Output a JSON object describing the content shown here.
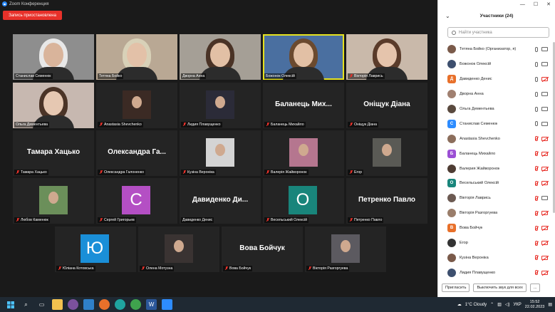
{
  "window": {
    "title": "Zoom Конференция",
    "record_button": "Запись приостановлена"
  },
  "gallery": [
    {
      "name": "Станислав Семенюк",
      "kind": "video",
      "muted": false
    },
    {
      "name": "Тетяна Бойко",
      "kind": "video",
      "muted": false
    },
    {
      "name": "Дворна Анна",
      "kind": "video",
      "muted": false
    },
    {
      "name": "Божонок Олексій",
      "kind": "video",
      "muted": false,
      "active": true
    },
    {
      "name": "Вікторія Лаврись",
      "kind": "video",
      "muted": true
    },
    {
      "name": "Ольга Дементьева",
      "kind": "video",
      "muted": false
    },
    {
      "name": "Anastasia Shevchenko",
      "kind": "photo",
      "muted": true
    },
    {
      "name": "Лидия Плавущенко",
      "kind": "photo",
      "muted": true
    },
    {
      "name": "Баланець Михайло",
      "kind": "text",
      "big": "Баланець Мих...",
      "muted": true
    },
    {
      "name": "Оніщук Діана",
      "kind": "text",
      "big": "Оніщук Діана",
      "muted": true
    },
    {
      "name": "Тамара Хацько",
      "kind": "text",
      "big": "Тамара Хацько",
      "muted": true
    },
    {
      "name": "Олександра Галоненко",
      "kind": "text",
      "big": "Олександра Га...",
      "muted": true
    },
    {
      "name": "Кузіна Вероніка",
      "kind": "photo",
      "muted": true
    },
    {
      "name": "Валерія Жайворонок",
      "kind": "photo",
      "muted": true
    },
    {
      "name": "Егор",
      "kind": "photo",
      "muted": true
    },
    {
      "name": "Любов Каменюк",
      "kind": "photo",
      "muted": true
    },
    {
      "name": "Сергей Григорьев",
      "kind": "letter",
      "letter": "С",
      "color": "#b44fc4",
      "muted": true
    },
    {
      "name": "Давиденко Денис",
      "kind": "text",
      "big": "Давиденко Ди...",
      "muted": false
    },
    {
      "name": "Весельський Олексій",
      "kind": "letter",
      "letter": "О",
      "color": "#19857b",
      "muted": true
    },
    {
      "name": "Петренко Павло",
      "kind": "text",
      "big": "Петренко Павло",
      "muted": true
    },
    {
      "name": "Юліана Котовська",
      "kind": "letter",
      "letter": "Ю",
      "color": "#1a8fd8",
      "muted": true
    },
    {
      "name": "Олена Мотузна",
      "kind": "photo",
      "muted": true
    },
    {
      "name": "Вова Бойчук",
      "kind": "text",
      "big": "Вова Бойчук",
      "muted": true
    },
    {
      "name": "Вікторія Разгоргуева",
      "kind": "photo",
      "muted": true
    }
  ],
  "panel": {
    "title": "Участники (24)",
    "search_placeholder": "Найти участника",
    "invite_button": "Пригласить",
    "mute_all_button": "Выключить звук для всех",
    "more_button": "...",
    "participants": [
      {
        "name": "Тетяна Бойко (Организатор, я)",
        "avatar": "photo",
        "mic": "on",
        "cam": "on"
      },
      {
        "name": "Божонок Олексій",
        "avatar": "photo",
        "mic": "on",
        "cam": "on"
      },
      {
        "name": "Давиденко Денис",
        "avatar": "letter",
        "letter": "Д",
        "color": "#e8702a",
        "mic": "on",
        "cam": "off"
      },
      {
        "name": "Дворна Анна",
        "avatar": "photo",
        "mic": "on",
        "cam": "on"
      },
      {
        "name": "Ольга Дементьева",
        "avatar": "photo",
        "mic": "on",
        "cam": "on"
      },
      {
        "name": "Станислав Семенюк",
        "avatar": "letter",
        "letter": "С",
        "color": "#2d8cff",
        "mic": "on",
        "cam": "on"
      },
      {
        "name": "Anastasia Shevchenko",
        "avatar": "photo",
        "mic": "off",
        "cam": "off"
      },
      {
        "name": "Баланець Михайло",
        "avatar": "letter",
        "letter": "Б",
        "color": "#9b4fd4",
        "mic": "off",
        "cam": "off"
      },
      {
        "name": "Валерия Жайворонок",
        "avatar": "photo",
        "mic": "off",
        "cam": "off"
      },
      {
        "name": "Весельський Олексій",
        "avatar": "letter",
        "letter": "О",
        "color": "#19857b",
        "mic": "off",
        "cam": "off"
      },
      {
        "name": "Вікторія Лаврись",
        "avatar": "photo",
        "mic": "off",
        "cam": "on"
      },
      {
        "name": "Вікторія Разгоргуева",
        "avatar": "photo",
        "mic": "off",
        "cam": "off"
      },
      {
        "name": "Вова Бойчук",
        "avatar": "letter",
        "letter": "В",
        "color": "#e8702a",
        "mic": "off",
        "cam": "off"
      },
      {
        "name": "Егор",
        "avatar": "photo",
        "mic": "off",
        "cam": "off"
      },
      {
        "name": "Кузіна Вероніка",
        "avatar": "photo",
        "mic": "off",
        "cam": "off"
      },
      {
        "name": "Лидия Плавущенко",
        "avatar": "photo",
        "mic": "off",
        "cam": "off"
      }
    ]
  },
  "taskbar": {
    "weather": "1°C  Cloudy",
    "lang": "УКР",
    "time": "15:52",
    "date": "22.02.2023"
  }
}
